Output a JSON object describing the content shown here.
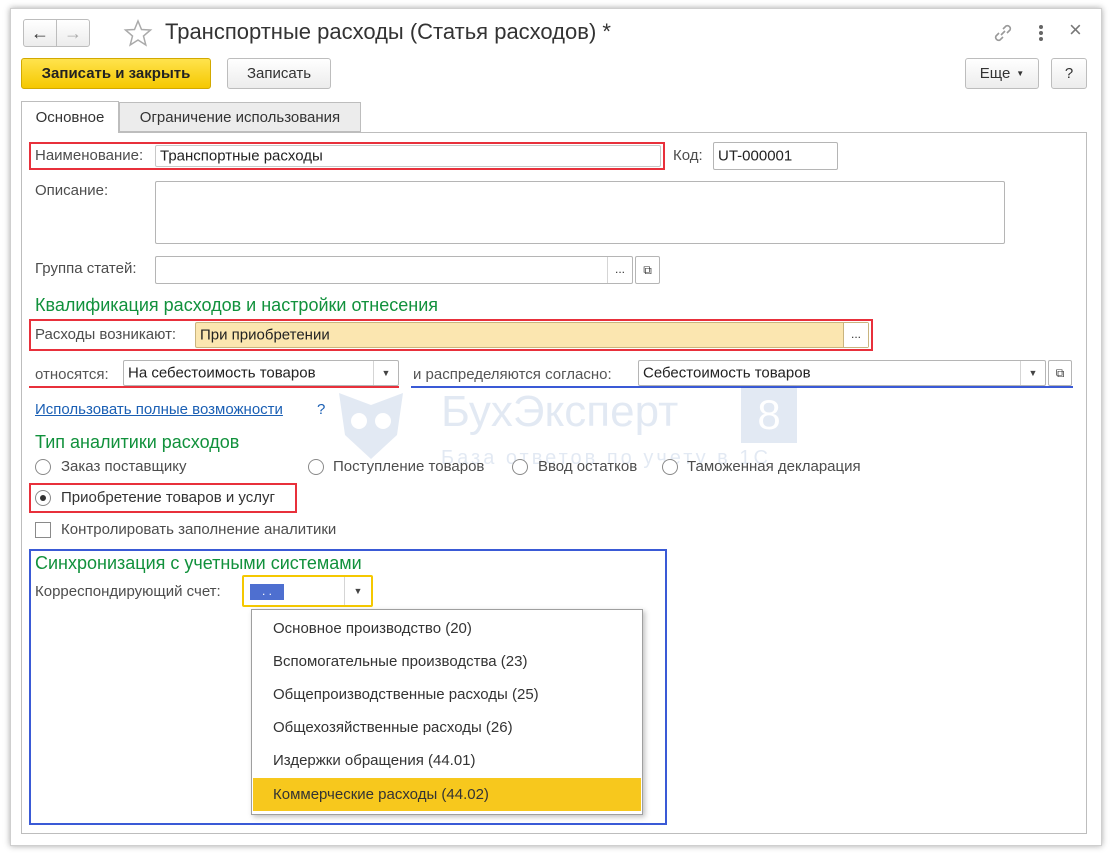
{
  "window": {
    "title": "Транспортные расходы (Статья расходов) *",
    "nav_back": "🡐",
    "nav_forward": "🡒",
    "star_icon": "star-icon",
    "link_icon": "link-icon",
    "menu_icon": "kebab-menu-icon",
    "close_glyph": "×"
  },
  "toolbar": {
    "save_close_label": "Записать и закрыть",
    "save_label": "Записать",
    "more_label": "Еще",
    "help_label": "?"
  },
  "tabs": [
    {
      "label": "Основное",
      "active": true
    },
    {
      "label": "Ограничение использования",
      "active": false
    }
  ],
  "form": {
    "name_label": "Наименование:",
    "name_value": "Транспортные расходы",
    "code_label": "Код:",
    "code_value": "UT-000001",
    "description_label": "Описание:",
    "description_value": "",
    "group_label": "Группа статей:",
    "group_value": "",
    "ellipsis": "...",
    "section_qualification": "Квалификация расходов и настройки отнесения",
    "arise_label": "Расходы возникают:",
    "arise_value": "При приобретении",
    "relate_label": "относятся:",
    "relate_value": "На себестоимость товаров",
    "distribute_label": "и распределяются согласно:",
    "distribute_value": "Себестоимость товаров",
    "full_features_link": "Использовать полные возможности",
    "help_q": "?",
    "section_analytics": "Тип аналитики расходов",
    "radios": [
      {
        "label": "Заказ поставщику",
        "selected": false
      },
      {
        "label": "Поступление товаров",
        "selected": false
      },
      {
        "label": "Ввод остатков",
        "selected": false
      },
      {
        "label": "Таможенная декларация",
        "selected": false
      },
      {
        "label": "Приобретение товаров и услуг",
        "selected": true
      }
    ],
    "control_checkbox_label": "Контролировать заполнение аналитики",
    "control_checked": false,
    "section_sync": "Синхронизация с учетными системами",
    "account_label": "Корреспондирующий счет:",
    "account_value": ". ."
  },
  "dropdown": {
    "items": [
      {
        "label": "Основное производство (20)",
        "active": false
      },
      {
        "label": "Вспомогательные производства (23)",
        "active": false
      },
      {
        "label": "Общепроизводственные расходы (25)",
        "active": false
      },
      {
        "label": "Общехозяйственные расходы (26)",
        "active": false
      },
      {
        "label": "Издержки обращения (44.01)",
        "active": false
      },
      {
        "label": "Коммерческие расходы (44.02)",
        "active": true
      }
    ]
  },
  "watermark": {
    "brand": "БухЭксперт",
    "digit": "8",
    "tagline": "База ответов по учету в 1С"
  },
  "colors": {
    "accent_yellow": "#f5c800",
    "section_green": "#11913c",
    "highlight_red": "#e8303b",
    "highlight_blue": "#3a5ad6",
    "selected_item": "#f7c81d",
    "field_yellow": "#fbe6b0"
  }
}
